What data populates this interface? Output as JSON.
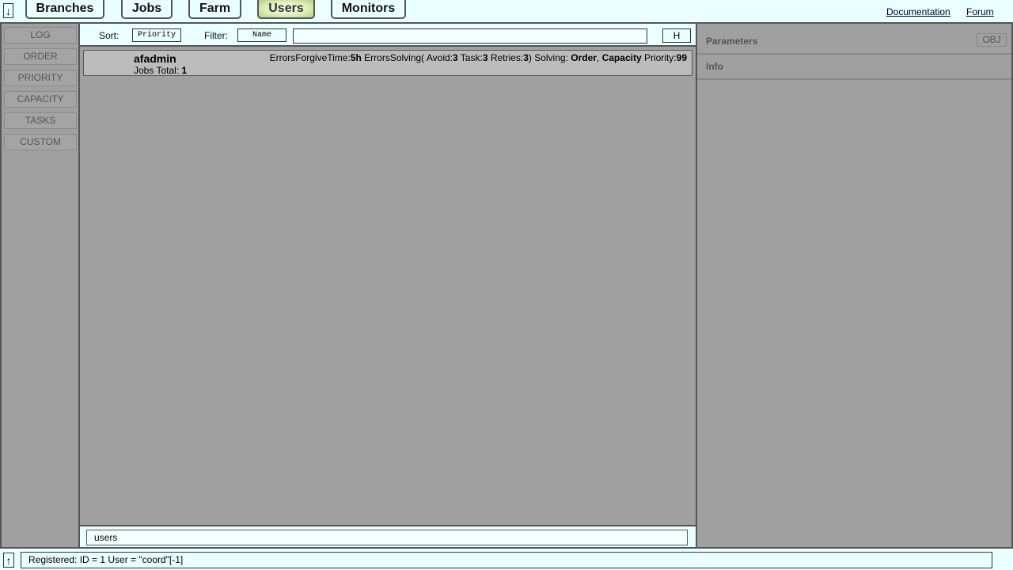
{
  "header": {
    "toggle_icon": "↓",
    "nav": [
      {
        "label": "Branches"
      },
      {
        "label": "Jobs"
      },
      {
        "label": "Farm"
      },
      {
        "label": "Users",
        "active": true
      },
      {
        "label": "Monitors"
      }
    ],
    "links": {
      "documentation": "Documentation",
      "forum": "Forum"
    }
  },
  "sidebar": {
    "items": [
      {
        "label": "LOG"
      },
      {
        "label": "ORDER"
      },
      {
        "label": "PRIORITY"
      },
      {
        "label": "CAPACITY"
      },
      {
        "label": "TASKS"
      },
      {
        "label": "CUSTOM"
      }
    ]
  },
  "controls": {
    "sort_label": "Sort:",
    "sort_value": "Priority",
    "filter_label": "Filter:",
    "filter_field": "Name",
    "filter_value": "",
    "h_label": "H"
  },
  "users": [
    {
      "name": "afadmin",
      "jobs_label": "Jobs Total:",
      "jobs_total": "1",
      "props": {
        "eft_label": "ErrorsForgiveTime:",
        "eft_value": "5h",
        "es_label": " ErrorsSolving( Avoid:",
        "avoid": "3",
        "task_label": " Task:",
        "task": "3",
        "retries_label": " Retries:",
        "retries": "3",
        "solving_label": ") Solving: ",
        "order": "Order",
        "sep": ", ",
        "capacity": "Capacity",
        "priority_label": " Priority:",
        "priority": "99"
      }
    }
  ],
  "command": {
    "value": "users"
  },
  "right_panel": {
    "parameters_title": "Parameters",
    "obj_label": "OBJ",
    "info_title": "Info"
  },
  "status": {
    "toggle_icon": "↑",
    "text": "Registered: ID = 1 User = \"coord\"[-1]"
  },
  "colors": {
    "panel_bg": "#eaffff",
    "workspace_bg": "#a0a0a0",
    "active_tab": "#dfeeb8",
    "row_bg": "#bcbcbc"
  }
}
